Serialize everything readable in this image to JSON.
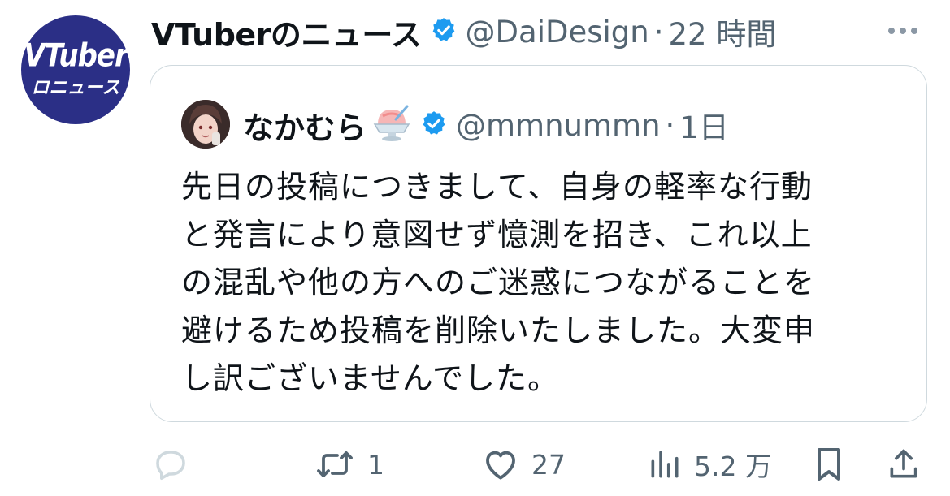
{
  "tweet": {
    "author": {
      "avatar_lines": [
        "VTuber",
        "ロニュース"
      ],
      "name": "VTuberのニュース",
      "handle": "@DaiDesign",
      "separator": "·",
      "time": "22 時間"
    },
    "quote": {
      "author": {
        "name": "なかむら",
        "handle": "@mmnummn",
        "separator": "·",
        "time": "1日"
      },
      "text_lines": [
        "先日の投稿につきまして、自身の軽率な行動",
        "と発言により意図せず憶測を招き、これ以上",
        "の混乱や他の方へのご迷惑につながることを",
        "避けるため投稿を削除いたしました。大変申",
        "し訳ございませんでした。"
      ]
    },
    "actions": {
      "reply_count": "",
      "retweet_count": "1",
      "like_count": "27",
      "views_count": "5.2 万"
    }
  },
  "icons": {
    "verified": "verified-badge-icon",
    "more": "more-icon",
    "reply": "reply-icon",
    "retweet": "retweet-icon",
    "like": "heart-icon",
    "views": "views-chart-icon",
    "bookmark": "bookmark-icon",
    "share": "share-icon"
  },
  "colors": {
    "text": "#0f1419",
    "secondary": "#536471",
    "verified": "#1d9bf0",
    "border": "#cfd9de",
    "avatar_bg": "#2b2f86"
  }
}
